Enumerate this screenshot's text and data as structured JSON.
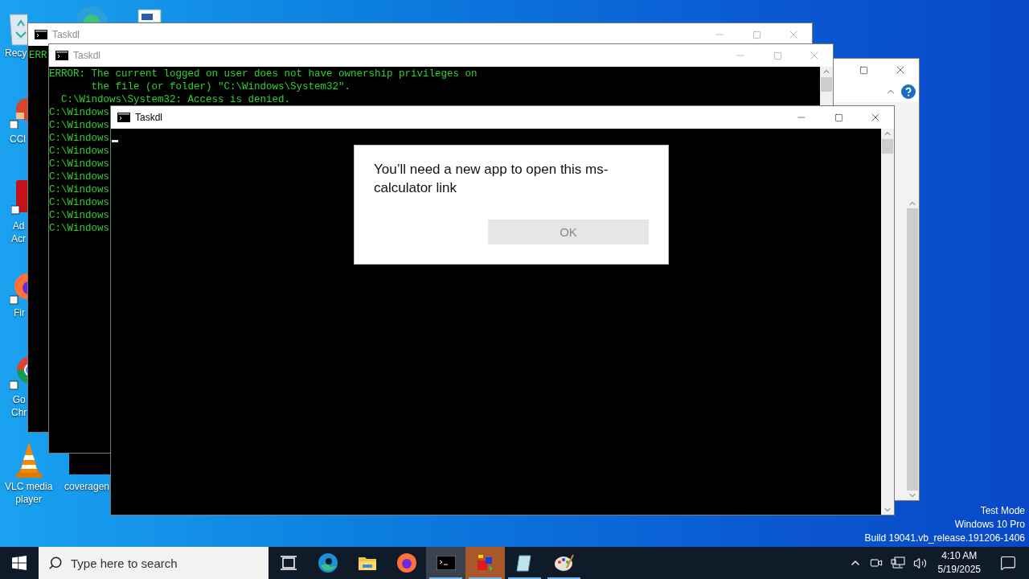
{
  "desktop": {
    "icons": [
      {
        "kind": "recycle-bin",
        "label_lines": [
          "Recy"
        ]
      },
      {
        "kind": "edge"
      },
      {
        "kind": "document"
      },
      {
        "kind": "ccleaner",
        "label_lines": [
          "CCl"
        ]
      },
      {
        "kind": "acrobat",
        "label_lines": [
          "Ad",
          "Acr"
        ]
      },
      {
        "kind": "firefox",
        "label_lines": [
          "Fir"
        ]
      },
      {
        "kind": "chrome",
        "label_lines": [
          "Go",
          "Chr"
        ]
      },
      {
        "kind": "vlc",
        "label_lines": [
          "VLC media",
          "player"
        ]
      },
      {
        "kind": "blank",
        "label_lines": [
          "coveragen"
        ]
      }
    ],
    "system_notice": [
      "Test Mode",
      "Windows 10 Pro",
      "Build 19041.vb_release.191206-1406"
    ]
  },
  "windows": [
    {
      "kind": "panel"
    },
    {
      "kind": "fragment"
    },
    {
      "kind": "console",
      "title": "Taskdl",
      "focused": false,
      "cursor": false,
      "lines": [
        "ERR"
      ]
    },
    {
      "kind": "console",
      "title": "Taskdl",
      "focused": false,
      "cursor": false,
      "lines": [
        "ERROR: The current logged on user does not have ownership privileges on",
        "       the file (or folder) \"C:\\Windows\\System32\".",
        "  C:\\Windows\\System32: Access is denied.",
        "C:\\Windows",
        "C:\\Windows",
        "C:\\Windows",
        "C:\\Windows",
        "C:\\Windows",
        "C:\\Windows",
        "C:\\Windows",
        "C:\\Windows",
        "C:\\Windows",
        "C:\\Windows"
      ]
    },
    {
      "kind": "console",
      "title": "Taskdl",
      "focused": true,
      "cursor": true
    }
  ],
  "dialog": {
    "message": "You’ll need a new app to open this ms-calculator link",
    "button": {
      "label": "OK",
      "disabled": true
    }
  },
  "taskbar": {
    "search": {
      "placeholder": "Type here to search"
    },
    "apps": [
      {
        "kind": "task-view",
        "running": false,
        "focused": false,
        "flashing": false
      },
      {
        "kind": "edge",
        "running": false,
        "focused": false,
        "flashing": false
      },
      {
        "kind": "explorer",
        "running": false,
        "focused": false,
        "flashing": false
      },
      {
        "kind": "firefox",
        "running": false,
        "focused": false,
        "flashing": false
      },
      {
        "kind": "console",
        "running": true,
        "focused": true,
        "flashing": false
      },
      {
        "kind": "packager",
        "running": true,
        "focused": false,
        "flashing": true
      },
      {
        "kind": "notepad",
        "running": true,
        "focused": false,
        "flashing": false
      },
      {
        "kind": "paint",
        "running": true,
        "focused": false,
        "flashing": false
      }
    ],
    "clock": {
      "time": "4:10 AM",
      "date": "5/19/2025"
    }
  }
}
